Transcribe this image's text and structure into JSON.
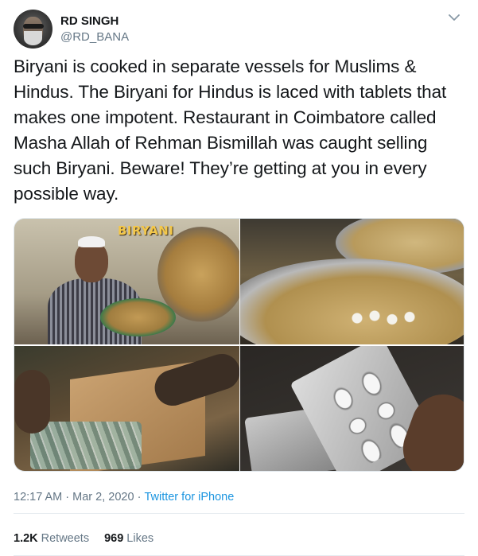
{
  "user": {
    "display_name": "RD SINGH",
    "handle": "@RD_BANA"
  },
  "tweet": {
    "text": "Biryani is cooked in separate vessels for Muslims & Hindus. The Biryani for Hindus is laced with tablets that makes one impotent. Restaurant in Coimbatore called Masha Allah of Rehman Bismillah was caught selling such Biryani. Beware! They’re getting at you in every possible way.",
    "image_label": "BIRYANI",
    "time": "12:17 AM",
    "separator": " · ",
    "date": "Mar 2, 2020",
    "source_separator": " · ",
    "source": "Twitter for iPhone"
  },
  "stats": {
    "retweets_count": "1.2K",
    "retweets_label": "Retweets",
    "likes_count": "969",
    "likes_label": "Likes"
  },
  "icons": {
    "menu": "chevron-down-icon"
  },
  "colors": {
    "link": "#1b95e0",
    "secondary_text": "#657786",
    "primary_text": "#14171a",
    "image_label": "#f3c74a"
  }
}
